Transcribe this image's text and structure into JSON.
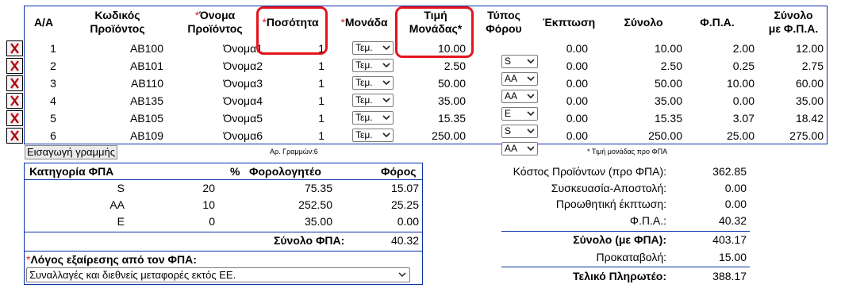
{
  "headers": {
    "aa": "Α/Α",
    "code_1": "Κωδικός",
    "code_2": "Προϊόντος",
    "name_1": "Όνομα",
    "name_2": "Προϊόντος",
    "qty": "Ποσότητα",
    "unit": "Μονάδα",
    "price_1": "Τιμή",
    "price_2": "Μονάδας",
    "tax_1": "Τύπος",
    "tax_2": "Φόρου",
    "disc": "Έκπτωση",
    "total": "Σύνολο",
    "vat": "Φ.Π.Α.",
    "grand_1": "Σύνολο",
    "grand_2": "με Φ.Π.Α.",
    "asterisk": "*"
  },
  "rows": [
    {
      "aa": "1",
      "code": "AB100",
      "name": "Όνομα1",
      "qty": "1",
      "unit": "Τεμ.",
      "price": "10.00",
      "tax": "S",
      "disc": "0.00",
      "total": "10.00",
      "vat": "2.00",
      "grand": "12.00"
    },
    {
      "aa": "2",
      "code": "AB101",
      "name": "Όνομα2",
      "qty": "1",
      "unit": "Τεμ.",
      "price": "2.50",
      "tax": "AA",
      "disc": "0.00",
      "total": "2.50",
      "vat": "0.25",
      "grand": "2.75"
    },
    {
      "aa": "3",
      "code": "AB110",
      "name": "Όνομα3",
      "qty": "1",
      "unit": "Τεμ.",
      "price": "50.00",
      "tax": "AA",
      "disc": "0.00",
      "total": "50.00",
      "vat": "10.00",
      "grand": "60.00"
    },
    {
      "aa": "4",
      "code": "AB135",
      "name": "Όνομα4",
      "qty": "1",
      "unit": "Τεμ.",
      "price": "35.00",
      "tax": "E",
      "disc": "0.00",
      "total": "35.00",
      "vat": "0.00",
      "grand": "35.00"
    },
    {
      "aa": "5",
      "code": "AB105",
      "name": "Όνομα5",
      "qty": "1",
      "unit": "Τεμ.",
      "price": "15.35",
      "tax": "S",
      "disc": "0.00",
      "total": "15.35",
      "vat": "3.07",
      "grand": "18.42"
    },
    {
      "aa": "6",
      "code": "AB109",
      "name": "Όνομα6",
      "qty": "1",
      "unit": "Τεμ.",
      "price": "250.00",
      "tax": "AA",
      "disc": "0.00",
      "total": "250.00",
      "vat": "25.00",
      "grand": "275.00"
    }
  ],
  "add_row_label": "Εισαγωγή γραμμής",
  "row_count_note": "Αρ. Γραμμών:6",
  "price_note": "* Τιμή μονάδας προ ΦΠΑ",
  "vat_table": {
    "h_category": "Κατηγορία ΦΠΑ",
    "h_percent": "%",
    "h_taxable": "Φορολογητέο",
    "h_tax": "Φόρος",
    "rows": [
      {
        "cat": "S",
        "pct": "20",
        "taxable": "75.35",
        "tax": "15.07"
      },
      {
        "cat": "AA",
        "pct": "10",
        "taxable": "252.50",
        "tax": "25.25"
      },
      {
        "cat": "E",
        "pct": "0",
        "taxable": "35.00",
        "tax": "0.00"
      }
    ],
    "total_label": "Σύνολο ΦΠΑ:",
    "total_value": "40.32",
    "reason_label": "Λόγος εξαίρεσης από τον ΦΠΑ:",
    "reason_value": "Συναλλαγές και διεθνείς μεταφορές εκτός ΕΕ."
  },
  "summary": {
    "products_cost_label": "Κόστος Προϊόντων (προ ΦΠΑ):",
    "products_cost": "362.85",
    "packaging_label": "Συσκευασία-Αποστολή:",
    "packaging": "0.00",
    "extra_discount_label": "Προωθητική έκπτωση:",
    "extra_discount": "0.00",
    "vat_label": "Φ.Π.Α.:",
    "vat": "40.32",
    "total_label": "Σύνολο (με ΦΠΑ):",
    "total": "403.17",
    "advance_label": "Προκαταβολή:",
    "advance": "15.00",
    "final_label": "Τελικό Πληρωτέο:",
    "final": "388.17"
  },
  "colors": {
    "border": "#0a2fa8",
    "highlight": "#e3141c",
    "required": "#e0202a"
  }
}
